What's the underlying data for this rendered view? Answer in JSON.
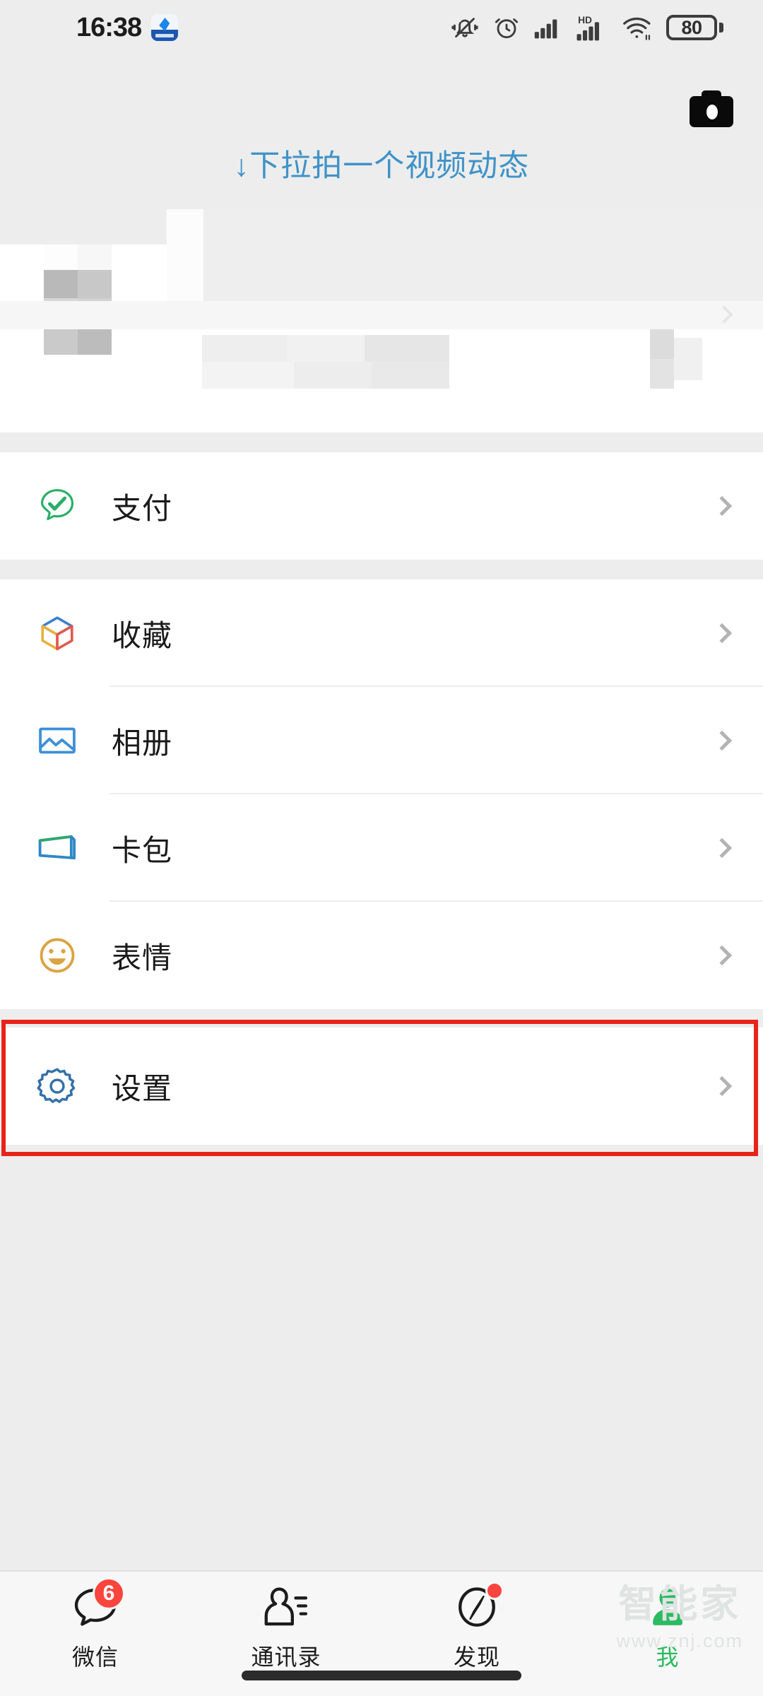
{
  "status_bar": {
    "time": "16:38",
    "app_icon_name": "blue-app-icon",
    "icons": [
      "mute-bell-icon",
      "alarm-clock-icon",
      "signal-bars-icon",
      "hd-signal-icon",
      "wifi-icon"
    ],
    "battery_level": "80"
  },
  "header": {
    "pull_hint": "↓下拉拍一个视频动态",
    "camera_button": "camera-icon"
  },
  "profile": {
    "redacted": true,
    "note": ""
  },
  "menu_groups": [
    {
      "items": [
        {
          "label": "支付",
          "icon": "pay-icon",
          "color": "#2aae67"
        }
      ]
    },
    {
      "items": [
        {
          "label": "收藏",
          "icon": "favorites-cube-icon",
          "color": "#3d7fd1"
        },
        {
          "label": "相册",
          "icon": "album-picture-icon",
          "color": "#3d8fd8"
        },
        {
          "label": "卡包",
          "icon": "cards-wallet-icon",
          "color": "#2d89c4"
        },
        {
          "label": "表情",
          "icon": "stickers-smiley-icon",
          "color": "#d9a441"
        }
      ]
    },
    {
      "items": [
        {
          "label": "设置",
          "icon": "settings-gear-icon",
          "color": "#3470a8"
        }
      ]
    }
  ],
  "annotation": {
    "type": "highlight-rectangle",
    "target": "设置",
    "color": "#e8231a"
  },
  "tabbar": {
    "tabs": [
      {
        "label": "微信",
        "icon": "chat-bubble-icon",
        "badge": "6",
        "active": false
      },
      {
        "label": "通讯录",
        "icon": "contacts-icon",
        "badge": "",
        "active": false
      },
      {
        "label": "发现",
        "icon": "compass-discover-icon",
        "badge": "dot",
        "active": false
      },
      {
        "label": "我",
        "icon": "profile-person-icon",
        "badge": "",
        "active": true
      }
    ],
    "active_color": "#2bbb61"
  },
  "watermark": {
    "main": "智能家",
    "sub": "www.znj.com"
  }
}
